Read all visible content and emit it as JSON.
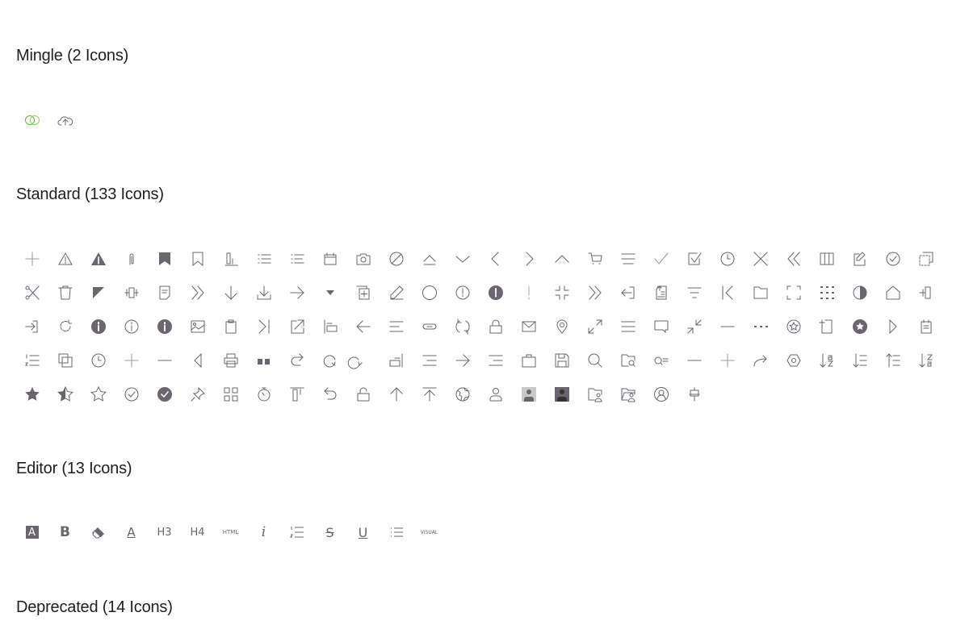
{
  "colors": {
    "icon": "#6b6570",
    "mingle_accent": "#5cc02c",
    "heading": "#1f1f1f"
  },
  "sections": {
    "mingle": {
      "title": "Mingle (2 Icons)",
      "icons": [
        "mingle-logo",
        "cloud-upload"
      ]
    },
    "standard": {
      "title": "Standard (133 Icons)",
      "icons": [
        "plus",
        "warning",
        "warning-filled",
        "attachment",
        "bookmark-filled",
        "bookmark",
        "chart-bar",
        "list-bulleted",
        "list-bulleted-small",
        "calendar",
        "camera",
        "ban",
        "eject",
        "chevron-down",
        "chevron-left",
        "chevron-right",
        "chevron-up",
        "cart",
        "menu",
        "check",
        "checkbox-checked",
        "clock",
        "close",
        "double-chevron-left",
        "columns",
        "edit",
        "check-circle",
        "copy-dashed",
        "cut",
        "trash",
        "corner-triangle",
        "compress-vertical",
        "note",
        "double-chevron-right",
        "arrow-down",
        "download",
        "arrow-right",
        "caret-down",
        "duplicate",
        "pencil",
        "circle",
        "exclamation-circle",
        "exclamation-filled",
        "exclamation",
        "collapse",
        "double-chevron-right-thin",
        "exit",
        "export-document",
        "filter",
        "first-page",
        "folder",
        "fullscreen",
        "grid-dots",
        "contrast",
        "home",
        "drag-horizontal",
        "login",
        "refresh",
        "info-filled",
        "info",
        "info-filled-alt",
        "image",
        "clipboard",
        "last-page",
        "external-link",
        "align-bottom-left",
        "arrow-left",
        "align-left",
        "link",
        "sync",
        "lock",
        "mail",
        "location",
        "expand",
        "menu-lines",
        "comment",
        "shrink",
        "minus",
        "more-horizontal",
        "star-circle",
        "new-document",
        "star-circle-filled",
        "play",
        "notes",
        "list-numbered",
        "copy",
        "clock-alt",
        "plus-thin",
        "minus-thin",
        "caret-left",
        "print",
        "quote",
        "redo",
        "rotate-right",
        "rotate-left",
        "align-bottom-right",
        "align-right",
        "arrow-right-thin",
        "indent",
        "briefcase",
        "save",
        "search",
        "folder-search",
        "search-list",
        "minus-alt",
        "plus-alt",
        "share",
        "settings-hex",
        "sort-a-z",
        "sort-descending",
        "sort-ascending",
        "sort-z-a",
        "star-filled",
        "star-half",
        "star",
        "check-circle-alt",
        "check-circle-filled",
        "pin",
        "grid",
        "stopwatch",
        "align-top",
        "undo",
        "unlock",
        "arrow-up",
        "upload",
        "globe",
        "user",
        "avatar-light",
        "avatar-dark",
        "folder-user",
        "folder-user-alt",
        "user-circle",
        "align-center"
      ]
    },
    "editor": {
      "title": "Editor (13 Icons)",
      "icons": [
        {
          "name": "text-background",
          "label": "A"
        },
        {
          "name": "bold",
          "label": "B"
        },
        {
          "name": "eraser",
          "label": ""
        },
        {
          "name": "text-color",
          "label": "A"
        },
        {
          "name": "heading-3",
          "label": "H3"
        },
        {
          "name": "heading-4",
          "label": "H4"
        },
        {
          "name": "html",
          "label": "HTML"
        },
        {
          "name": "italic",
          "label": "i"
        },
        {
          "name": "ordered-list",
          "label": ""
        },
        {
          "name": "strikethrough",
          "label": "S"
        },
        {
          "name": "underline",
          "label": "U"
        },
        {
          "name": "unordered-list",
          "label": ""
        },
        {
          "name": "visual",
          "label": "VISUAL"
        }
      ]
    },
    "deprecated": {
      "title": "Deprecated (14 Icons)"
    }
  }
}
